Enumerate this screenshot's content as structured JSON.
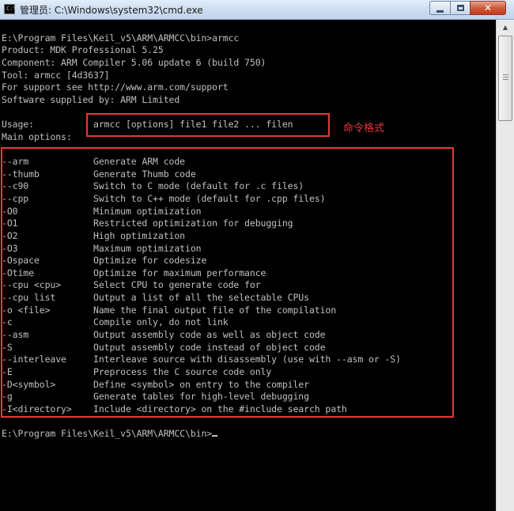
{
  "window": {
    "title": "管理员: C:\\Windows\\system32\\cmd.exe",
    "icon_text": "C:\\",
    "close_glyph": "✕"
  },
  "console": {
    "lines": [
      "",
      "E:\\Program Files\\Keil_v5\\ARM\\ARMCC\\bin>armcc",
      "Product: MDK Professional 5.25",
      "Component: ARM Compiler 5.06 update 6 (build 750)",
      "Tool: armcc [4d3637]",
      "For support see http://www.arm.com/support",
      "Software supplied by: ARM Limited",
      "",
      "Usage:           armcc [options] file1 file2 ... filen",
      "Main options:",
      "",
      "--arm            Generate ARM code",
      "--thumb          Generate Thumb code",
      "--c90            Switch to C mode (default for .c files)",
      "--cpp            Switch to C++ mode (default for .cpp files)",
      "-O0              Minimum optimization",
      "-O1              Restricted optimization for debugging",
      "-O2              High optimization",
      "-O3              Maximum optimization",
      "-Ospace          Optimize for codesize",
      "-Otime           Optimize for maximum performance",
      "--cpu <cpu>      Select CPU to generate code for",
      "--cpu list       Output a list of all the selectable CPUs",
      "-o <file>        Name the final output file of the compilation",
      "-c               Compile only, do not link",
      "--asm            Output assembly code as well as object code",
      "-S               Output assembly code instead of object code",
      "--interleave     Interleave source with disassembly (use with --asm or -S)",
      "-E               Preprocess the C source code only",
      "-D<symbol>       Define <symbol> on entry to the compiler",
      "-g               Generate tables for high-level debugging",
      "-I<directory>    Include <directory> on the #include search path",
      "",
      "E:\\Program Files\\Keil_v5\\ARM\\ARMCC\\bin>"
    ]
  },
  "annotation": {
    "label": "命令格式",
    "color": "#e8373b"
  },
  "scrollbar": {
    "up_glyph": "▲"
  }
}
